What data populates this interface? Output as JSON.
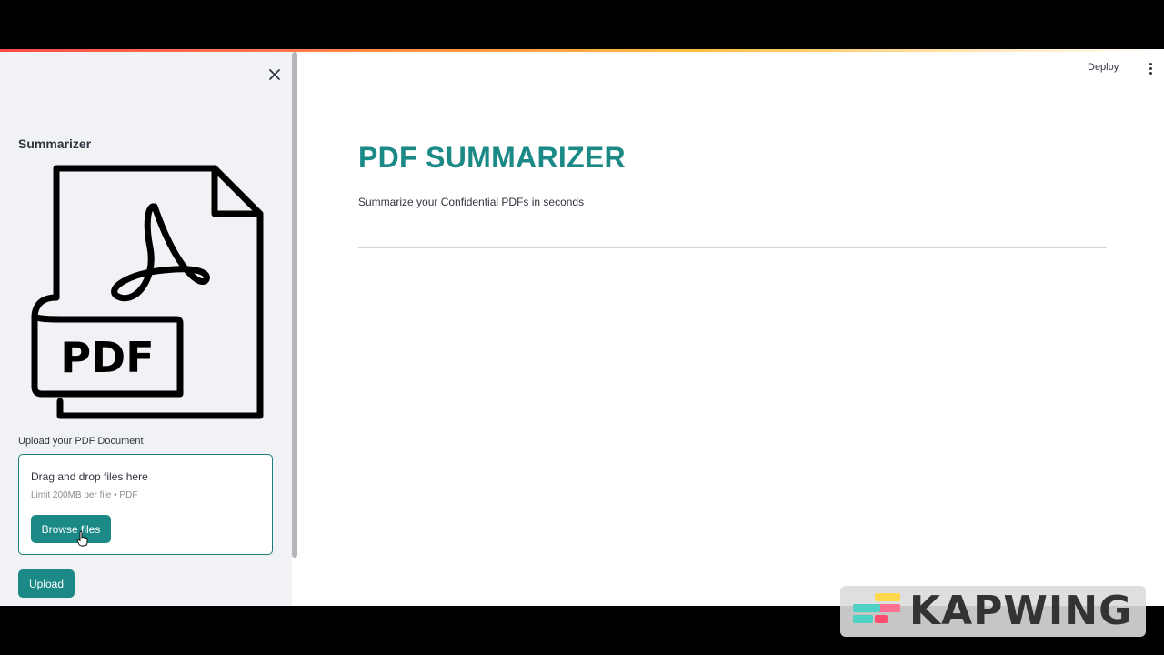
{
  "sidebar": {
    "title": "Summarizer",
    "upload_label": "Upload your PDF Document",
    "dropzone": {
      "title": "Drag and drop files here",
      "limit": "Limit 200MB per file • PDF",
      "browse_label": "Browse files"
    },
    "upload_button_label": "Upload",
    "illustration_text": "PDF"
  },
  "header": {
    "deploy_label": "Deploy"
  },
  "main": {
    "title": "PDF SUMMARIZER",
    "subtitle": "Summarize your Confidential PDFs in seconds"
  },
  "watermark": {
    "text": "KAPWING"
  },
  "colors": {
    "accent": "#1b8a86",
    "sidebar_bg": "#f0f2f6",
    "text": "#31333f"
  }
}
